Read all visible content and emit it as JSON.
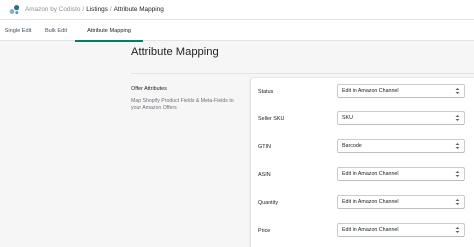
{
  "header": {
    "app_name": "Amazon by Codisto",
    "separator": "/",
    "crumb_listings": "Listings",
    "crumb_current": "Attribute Mapping"
  },
  "tabs": [
    {
      "label": "Single Edit",
      "active": false
    },
    {
      "label": "Bulk Edit",
      "active": false
    },
    {
      "label": "Attribute Mapping",
      "active": true
    }
  ],
  "page": {
    "title": "Attribute Mapping"
  },
  "section": {
    "heading": "Offer Attributes",
    "description": "Map Shopify Product Fields & Meta-Fields to your Amazon Offers"
  },
  "fields": [
    {
      "label": "Status",
      "value": "Edit in Amazon Channel"
    },
    {
      "label": "Seller SKU",
      "value": "SKU"
    },
    {
      "label": "GTIN",
      "value": "Barcode"
    },
    {
      "label": "ASIN",
      "value": "Edit in Amazon Channel"
    },
    {
      "label": "Quantity",
      "value": "Edit in Amazon Channel"
    },
    {
      "label": "Price",
      "value": "Edit in Amazon Channel"
    }
  ],
  "colors": {
    "accent": "#008060",
    "logo_light": "#7fb4c9",
    "logo_dark": "#2e6f8e"
  },
  "icons": {
    "logo": "codisto-logo-icon",
    "select_arrow": "chevron-up-down-icon"
  }
}
